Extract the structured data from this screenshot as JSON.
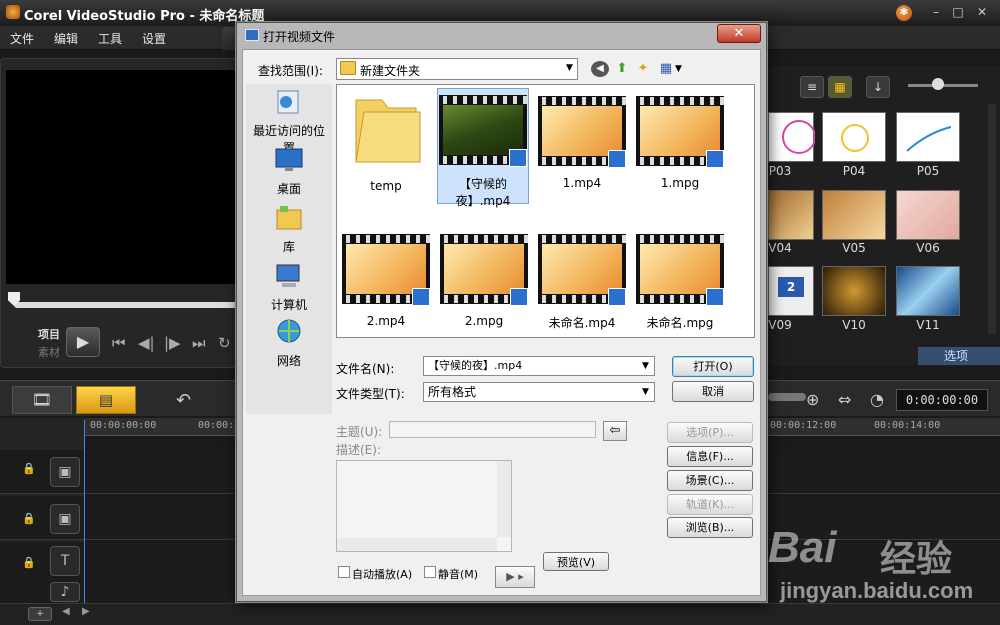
{
  "app": {
    "title": "Corel VideoStudio Pro - 未命名标题",
    "menu": [
      "文件",
      "编辑",
      "工具",
      "设置"
    ],
    "preview": {
      "project_label": "项目",
      "clip_label": "素材"
    },
    "library": {
      "thumbnails": [
        {
          "label": "P03",
          "style": "drawing"
        },
        {
          "label": "P04",
          "style": "drawing"
        },
        {
          "label": "P05",
          "style": "drawing"
        },
        {
          "label": "V04",
          "style": "sepia"
        },
        {
          "label": "V05",
          "style": "sepia"
        },
        {
          "label": "V06",
          "style": "pink"
        },
        {
          "label": "V09",
          "style": "monitor"
        },
        {
          "label": "V10",
          "style": "dark"
        },
        {
          "label": "V11",
          "style": "blue"
        }
      ],
      "monitor_digit": "2",
      "options_tab": "选项"
    },
    "timeline": {
      "timecode": "0:00:00:00",
      "ruler": [
        "00:00:00:00",
        "00:00:02",
        "00:00:12:00",
        "00:00:14:00"
      ]
    }
  },
  "dialog": {
    "title": "打开视频文件",
    "look_in_label": "查找范围(I):",
    "look_in_value": "新建文件夹",
    "places": [
      {
        "label": "最近访问的位置",
        "icon": "recent-places-icon"
      },
      {
        "label": "桌面",
        "icon": "desktop-icon"
      },
      {
        "label": "库",
        "icon": "library-icon"
      },
      {
        "label": "计算机",
        "icon": "computer-icon"
      },
      {
        "label": "网络",
        "icon": "network-icon"
      }
    ],
    "files": [
      {
        "name": "temp",
        "type": "folder"
      },
      {
        "name": "【守候的夜】.mp4",
        "type": "video-photo",
        "selected": true
      },
      {
        "name": "1.mp4",
        "type": "video"
      },
      {
        "name": "1.mpg",
        "type": "video"
      },
      {
        "name": "2.mp4",
        "type": "video"
      },
      {
        "name": "2.mpg",
        "type": "video"
      },
      {
        "name": "未命名.mp4",
        "type": "video"
      },
      {
        "name": "未命名.mpg",
        "type": "video"
      }
    ],
    "filename_label": "文件名(N):",
    "filename_value": "【守候的夜】.mp4",
    "filetype_label": "文件类型(T):",
    "filetype_value": "所有格式",
    "open_button": "打开(O)",
    "cancel_button": "取消",
    "subject_label": "主题(U):",
    "description_label": "描述(E):",
    "options_button": "选项(P)...",
    "info_button": "信息(F)...",
    "scene_button": "场景(C)...",
    "track_button": "轨道(K)...",
    "browse_button": "浏览(B)...",
    "autoplay_label": "自动播放(A)",
    "mute_label": "静音(M)",
    "preview_button": "预览(V)"
  },
  "watermark": {
    "brand": "Bai",
    "suffix": "经验",
    "url": "jingyan.baidu.com"
  }
}
